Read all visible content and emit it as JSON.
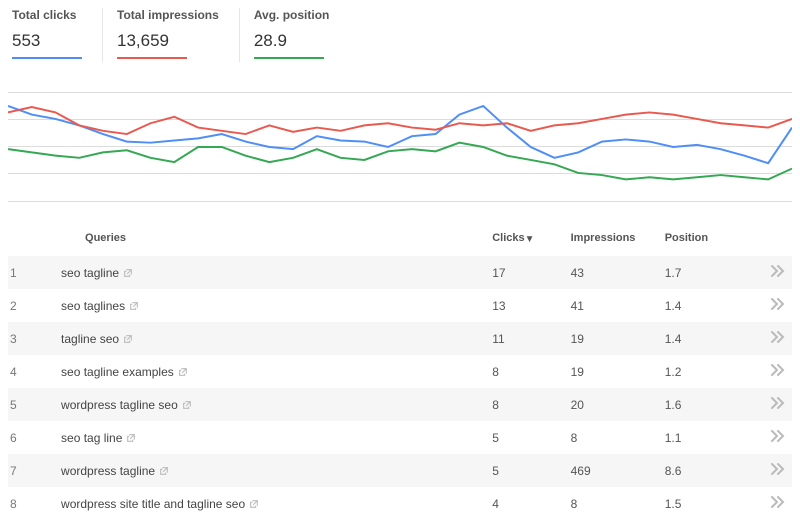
{
  "metrics": [
    {
      "label": "Total clicks",
      "value": "553",
      "colorClass": "u-blue"
    },
    {
      "label": "Total impressions",
      "value": "13,659",
      "colorClass": "u-red"
    },
    {
      "label": "Avg. position",
      "value": "28.9",
      "colorClass": "u-green"
    }
  ],
  "chart_data": {
    "type": "line",
    "x": [
      0,
      1,
      2,
      3,
      4,
      5,
      6,
      7,
      8,
      9,
      10,
      11,
      12,
      13,
      14,
      15,
      16,
      17,
      18,
      19,
      20,
      21,
      22,
      23,
      24,
      25,
      26,
      27,
      28,
      29,
      30,
      31,
      32,
      33
    ],
    "ylim": [
      0,
      100
    ],
    "yticks": [
      25,
      50,
      75
    ],
    "xlabel": "",
    "ylabel": "",
    "colors": {
      "Clicks": "#4f8ef7",
      "Impressions": "#e85a4f",
      "Position": "#34a853"
    },
    "series": [
      {
        "name": "Clicks",
        "values": [
          88,
          80,
          76,
          70,
          62,
          55,
          54,
          56,
          58,
          62,
          55,
          50,
          48,
          60,
          56,
          55,
          50,
          60,
          62,
          80,
          88,
          68,
          50,
          40,
          45,
          55,
          57,
          55,
          50,
          52,
          48,
          42,
          35,
          68
        ]
      },
      {
        "name": "Impressions",
        "values": [
          82,
          87,
          82,
          70,
          65,
          62,
          72,
          78,
          68,
          65,
          62,
          70,
          64,
          68,
          65,
          70,
          72,
          68,
          66,
          72,
          70,
          72,
          65,
          70,
          72,
          76,
          80,
          82,
          80,
          76,
          72,
          70,
          68,
          76
        ]
      },
      {
        "name": "Position",
        "values": [
          48,
          45,
          42,
          40,
          45,
          47,
          40,
          36,
          50,
          50,
          42,
          36,
          40,
          48,
          40,
          38,
          46,
          48,
          46,
          54,
          50,
          42,
          38,
          34,
          26,
          24,
          20,
          22,
          20,
          22,
          24,
          22,
          20,
          30
        ]
      }
    ]
  },
  "columns": {
    "queries": "Queries",
    "clicks": "Clicks",
    "impressions": "Impressions",
    "position": "Position"
  },
  "sort": {
    "column": "clicks",
    "direction": "desc"
  },
  "rows": [
    {
      "n": 1,
      "query": "seo tagline",
      "clicks": 17,
      "impressions": 43,
      "position": "1.7"
    },
    {
      "n": 2,
      "query": "seo taglines",
      "clicks": 13,
      "impressions": 41,
      "position": "1.4"
    },
    {
      "n": 3,
      "query": "tagline seo",
      "clicks": 11,
      "impressions": 19,
      "position": "1.4"
    },
    {
      "n": 4,
      "query": "seo tagline examples",
      "clicks": 8,
      "impressions": 19,
      "position": "1.2"
    },
    {
      "n": 5,
      "query": "wordpress tagline seo",
      "clicks": 8,
      "impressions": 20,
      "position": "1.6"
    },
    {
      "n": 6,
      "query": "seo tag line",
      "clicks": 5,
      "impressions": 8,
      "position": "1.1"
    },
    {
      "n": 7,
      "query": "wordpress tagline",
      "clicks": 5,
      "impressions": 469,
      "position": "8.6"
    },
    {
      "n": 8,
      "query": "wordpress site title and tagline seo",
      "clicks": 4,
      "impressions": 8,
      "position": "1.5"
    }
  ]
}
